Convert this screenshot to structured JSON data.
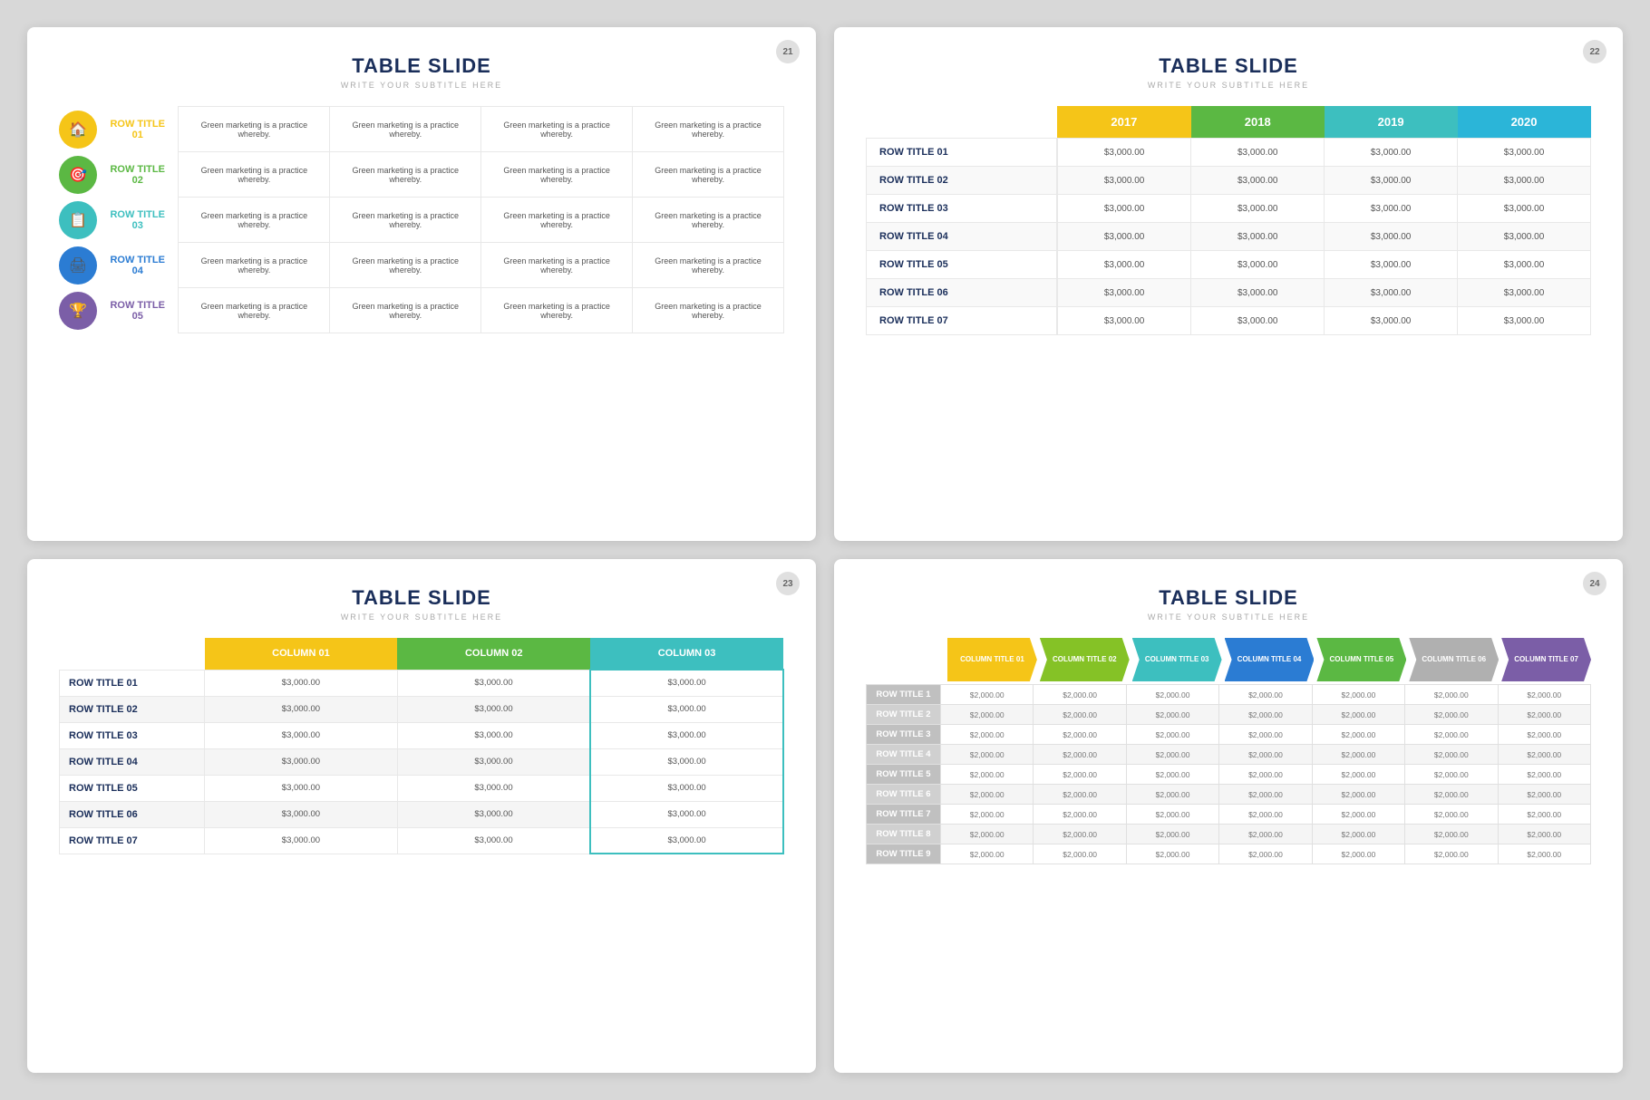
{
  "slide1": {
    "title": "TABLE SLIDE",
    "subtitle": "WRITE YOUR SUBTITLE HERE",
    "number": "21",
    "rows": [
      {
        "label": "ROW TITLE 01",
        "color": "yellow",
        "icon": "🏠",
        "cells": [
          "Green marketing is a practice whereby.",
          "Green marketing is a practice whereby.",
          "Green marketing is a practice whereby.",
          "Green marketing is a practice whereby."
        ]
      },
      {
        "label": "ROW TITLE 02",
        "color": "green",
        "icon": "🎯",
        "cells": [
          "Green marketing is a practice whereby.",
          "Green marketing is a practice whereby.",
          "Green marketing is a practice whereby.",
          "Green marketing is a practice whereby."
        ]
      },
      {
        "label": "ROW TITLE 03",
        "color": "teal",
        "icon": "📋",
        "cells": [
          "Green marketing is a practice whereby.",
          "Green marketing is a practice whereby.",
          "Green marketing is a practice whereby.",
          "Green marketing is a practice whereby."
        ]
      },
      {
        "label": "ROW TITLE 04",
        "color": "blue",
        "icon": "🖨",
        "cells": [
          "Green marketing is a practice whereby.",
          "Green marketing is a practice whereby.",
          "Green marketing is a practice whereby.",
          "Green marketing is a practice whereby."
        ]
      },
      {
        "label": "ROW TITLE 05",
        "color": "purple",
        "icon": "🏆",
        "cells": [
          "Green marketing is a practice whereby.",
          "Green marketing is a practice whereby.",
          "Green marketing is a practice whereby.",
          "Green marketing is a practice whereby."
        ]
      }
    ]
  },
  "slide2": {
    "title": "TABLE SLIDE",
    "subtitle": "WRITE YOUR SUBTITLE HERE",
    "number": "22",
    "columns": [
      "2017",
      "2018",
      "2019",
      "2020"
    ],
    "colColors": [
      "yellow",
      "green",
      "teal",
      "cyan"
    ],
    "rows": [
      {
        "label": "ROW TITLE 01",
        "cells": [
          "$3,000.00",
          "$3,000.00",
          "$3,000.00",
          "$3,000.00"
        ]
      },
      {
        "label": "ROW TITLE 02",
        "cells": [
          "$3,000.00",
          "$3,000.00",
          "$3,000.00",
          "$3,000.00"
        ]
      },
      {
        "label": "ROW TITLE 03",
        "cells": [
          "$3,000.00",
          "$3,000.00",
          "$3,000.00",
          "$3,000.00"
        ]
      },
      {
        "label": "ROW TITLE 04",
        "cells": [
          "$3,000.00",
          "$3,000.00",
          "$3,000.00",
          "$3,000.00"
        ]
      },
      {
        "label": "ROW TITLE 05",
        "cells": [
          "$3,000.00",
          "$3,000.00",
          "$3,000.00",
          "$3,000.00"
        ]
      },
      {
        "label": "ROW TITLE 06",
        "cells": [
          "$3,000.00",
          "$3,000.00",
          "$3,000.00",
          "$3,000.00"
        ]
      },
      {
        "label": "ROW TITLE 07",
        "cells": [
          "$3,000.00",
          "$3,000.00",
          "$3,000.00",
          "$3,000.00"
        ]
      }
    ]
  },
  "slide3": {
    "title": "TABLE SLIDE",
    "subtitle": "WRITE YOUR SUBTITLE HERE",
    "number": "23",
    "columns": [
      "COLUMN 01",
      "COLUMN 02",
      "COLUMN 03"
    ],
    "rows": [
      {
        "label": "ROW TITLE 01",
        "cells": [
          "$3,000.00",
          "$3,000.00",
          "$3,000.00"
        ]
      },
      {
        "label": "ROW TITLE 02",
        "cells": [
          "$3,000.00",
          "$3,000.00",
          "$3,000.00"
        ]
      },
      {
        "label": "ROW TITLE 03",
        "cells": [
          "$3,000.00",
          "$3,000.00",
          "$3,000.00"
        ]
      },
      {
        "label": "ROW TITLE 04",
        "cells": [
          "$3,000.00",
          "$3,000.00",
          "$3,000.00"
        ]
      },
      {
        "label": "ROW TITLE 05",
        "cells": [
          "$3,000.00",
          "$3,000.00",
          "$3,000.00"
        ]
      },
      {
        "label": "ROW TITLE 06",
        "cells": [
          "$3,000.00",
          "$3,000.00",
          "$3,000.00"
        ]
      },
      {
        "label": "ROW TITLE 07",
        "cells": [
          "$3,000.00",
          "$3,000.00",
          "$3,000.00"
        ]
      }
    ]
  },
  "slide4": {
    "title": "TABLE SLIDE",
    "subtitle": "WRITE YOUR SUBTITLE HERE",
    "number": "24",
    "columns": [
      "COLUMN TITLE 01",
      "COLUMN TITLE 02",
      "COLUMN TITLE 03",
      "COLUMN TITLE 04",
      "COLUMN TITLE 05",
      "COLUMN TITLE 06",
      "COLUMN TITLE 07"
    ],
    "rows": [
      {
        "label": "ROW TITLE 1",
        "cells": [
          "$2,000.00",
          "$2,000.00",
          "$2,000.00",
          "$2,000.00",
          "$2,000.00",
          "$2,000.00",
          "$2,000.00"
        ]
      },
      {
        "label": "ROW TITLE 2",
        "cells": [
          "$2,000.00",
          "$2,000.00",
          "$2,000.00",
          "$2,000.00",
          "$2,000.00",
          "$2,000.00",
          "$2,000.00"
        ]
      },
      {
        "label": "ROW TITLE 3",
        "cells": [
          "$2,000.00",
          "$2,000.00",
          "$2,000.00",
          "$2,000.00",
          "$2,000.00",
          "$2,000.00",
          "$2,000.00"
        ]
      },
      {
        "label": "ROW TITLE 4",
        "cells": [
          "$2,000.00",
          "$2,000.00",
          "$2,000.00",
          "$2,000.00",
          "$2,000.00",
          "$2,000.00",
          "$2,000.00"
        ]
      },
      {
        "label": "ROW TITLE 5",
        "cells": [
          "$2,000.00",
          "$2,000.00",
          "$2,000.00",
          "$2,000.00",
          "$2,000.00",
          "$2,000.00",
          "$2,000.00"
        ]
      },
      {
        "label": "ROW TITLE 6",
        "cells": [
          "$2,000.00",
          "$2,000.00",
          "$2,000.00",
          "$2,000.00",
          "$2,000.00",
          "$2,000.00",
          "$2,000.00"
        ]
      },
      {
        "label": "ROW TITLE 7",
        "cells": [
          "$2,000.00",
          "$2,000.00",
          "$2,000.00",
          "$2,000.00",
          "$2,000.00",
          "$2,000.00",
          "$2,000.00"
        ]
      },
      {
        "label": "ROW TITLE 8",
        "cells": [
          "$2,000.00",
          "$2,000.00",
          "$2,000.00",
          "$2,000.00",
          "$2,000.00",
          "$2,000.00",
          "$2,000.00"
        ]
      },
      {
        "label": "ROW TITLE 9",
        "cells": [
          "$2,000.00",
          "$2,000.00",
          "$2,000.00",
          "$2,000.00",
          "$2,000.00",
          "$2,000.00",
          "$2,000.00"
        ]
      }
    ]
  }
}
